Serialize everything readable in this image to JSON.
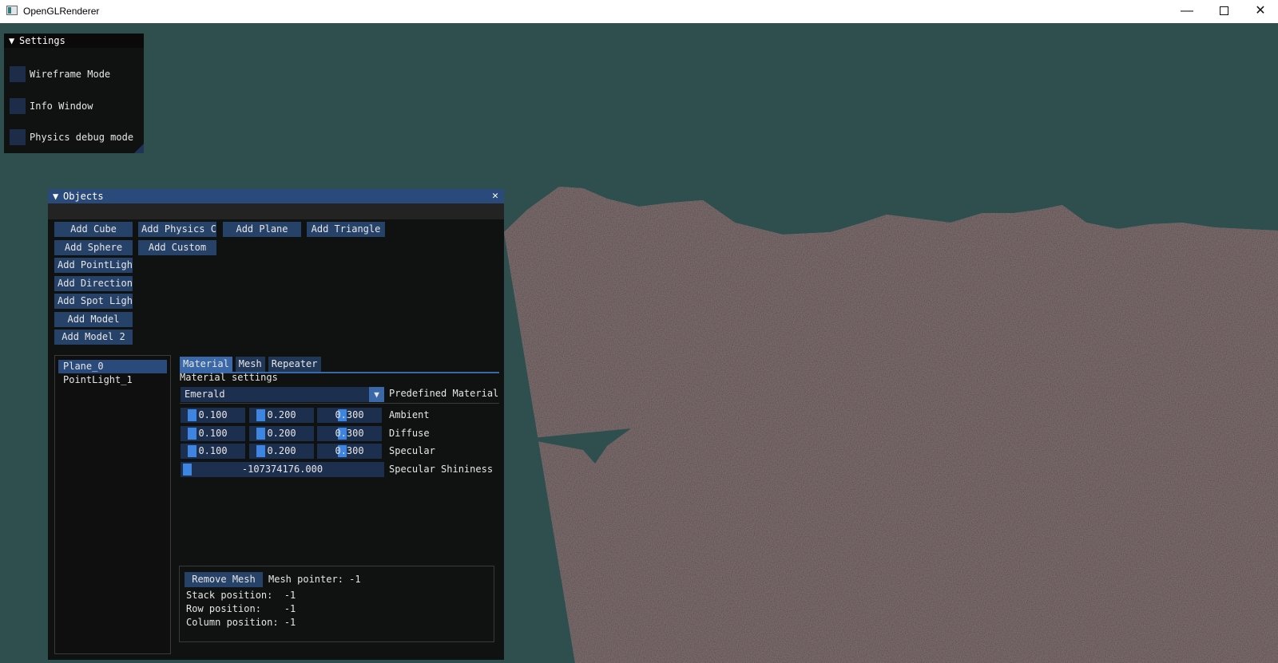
{
  "window": {
    "title": "OpenGLRenderer",
    "minimize_label": "—",
    "close_label": "✕"
  },
  "settings": {
    "title": "Settings",
    "arrow": "▼",
    "checkboxes": [
      {
        "label": "Wireframe Mode",
        "checked": false
      },
      {
        "label": "Info Window",
        "checked": false
      },
      {
        "label": "Physics debug mode",
        "checked": false
      }
    ]
  },
  "objects": {
    "title": "Objects",
    "arrow": "▼",
    "close": "✕",
    "buttons": {
      "add_cube": "Add Cube",
      "add_physics_cube": "Add Physics Cu",
      "add_plane": "Add Plane",
      "add_triangle": "Add Triangle",
      "add_sphere": "Add Sphere",
      "add_custom": "Add Custom",
      "add_pointlight": "Add PointLight",
      "add_directional": "Add Directiona",
      "add_spotlight": "Add Spot Light",
      "add_model": "Add Model",
      "add_model_2": "Add Model 2"
    },
    "list": [
      "Plane_0",
      "PointLight_1"
    ],
    "selected_index": 0,
    "tabs": [
      "Material",
      "Mesh",
      "Repeater"
    ],
    "active_tab": 0,
    "material": {
      "heading": "Material settings",
      "predefined_value": "Emerald",
      "predefined_label": "Predefined Material",
      "combo_arrow": "▼",
      "rows": [
        {
          "label": "Ambient",
          "values": [
            "0.100",
            "0.200",
            "0.300"
          ]
        },
        {
          "label": "Diffuse",
          "values": [
            "0.100",
            "0.200",
            "0.300"
          ]
        },
        {
          "label": "Specular",
          "values": [
            "0.100",
            "0.200",
            "0.300"
          ]
        }
      ],
      "shininess_label": "Specular Shininess",
      "shininess_value": "-107374176.000"
    },
    "mesh": {
      "remove_button": "Remove Mesh",
      "pointer_line": "Mesh pointer: -1",
      "stack_line": "Stack position:  -1",
      "row_line": "Row position:    -1",
      "column_line": "Column position: -1"
    }
  },
  "colors": {
    "background": "#2f4f4f",
    "button": "#274268",
    "accent": "#3b68a8",
    "terrain": "#6e5e5e"
  }
}
